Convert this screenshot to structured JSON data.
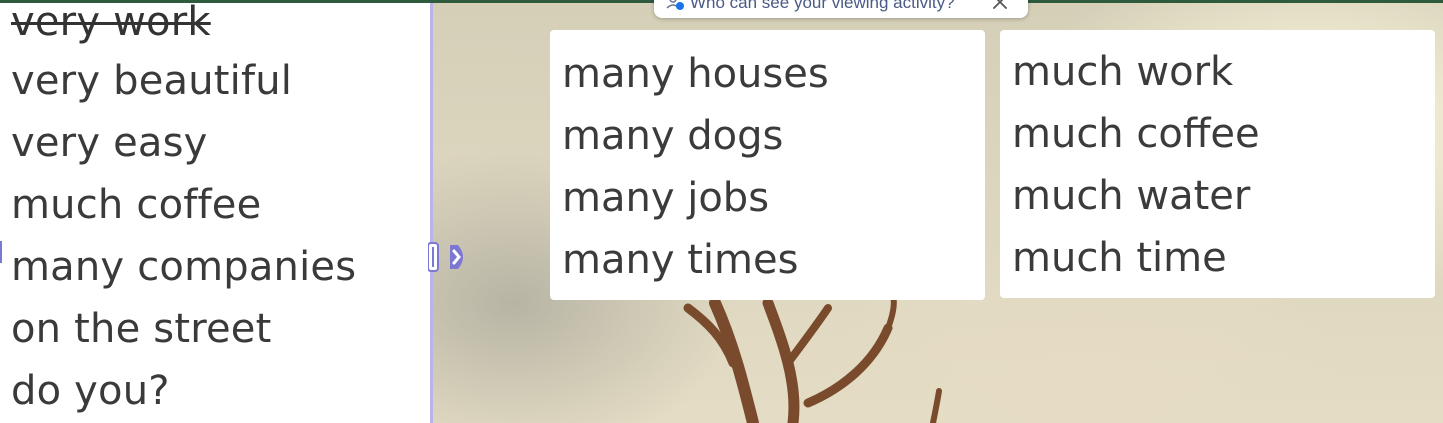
{
  "notice": {
    "text": "Who can see your viewing activity?",
    "close_icon": "close-icon",
    "people_icon": "people-icon"
  },
  "whiteboard": {
    "struck_item": "very work",
    "items": [
      "very beautiful",
      "very easy",
      "much coffee",
      "many companies",
      "on the street",
      "do you?"
    ]
  },
  "cards": {
    "many": [
      "many houses",
      "many dogs",
      "many jobs",
      "many times"
    ],
    "much": [
      "much work",
      "much coffee",
      "much water",
      "much time"
    ]
  },
  "colors": {
    "panel_edge": "#b9b4ec",
    "handle": "#7b78d4",
    "text": "#3a3a3a",
    "notice_text": "#4a5a86"
  }
}
